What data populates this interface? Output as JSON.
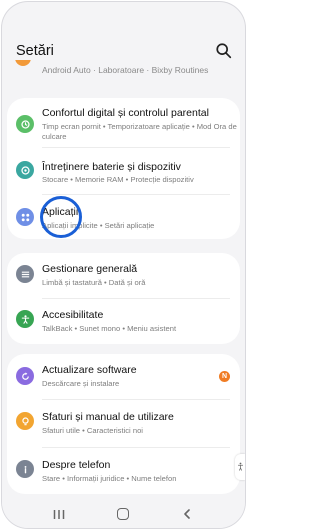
{
  "header": {
    "title": "Setări"
  },
  "partial_row": {
    "text": "Android Auto · Laboratoare · Bixby Routines"
  },
  "groups": [
    [
      {
        "title": "Confortul digital și controlul parental",
        "subtitle": "Timp ecran pornit • Temporizatoare aplicație • Mod Ora de culcare",
        "icon": "digital-wellbeing-icon",
        "color": "#5bbf68"
      },
      {
        "title": "Întreținere baterie și dispozitiv",
        "subtitle": "Stocare • Memorie RAM • Protecție dispozitiv",
        "icon": "device-care-icon",
        "color": "#3aa7a0"
      },
      {
        "title": "Aplicații",
        "subtitle": "Aplicații implicite • Setări aplicație",
        "icon": "apps-icon",
        "color": "#6f8fe6"
      }
    ],
    [
      {
        "title": "Gestionare generală",
        "subtitle": "Limbă și tastatură • Dată și oră",
        "icon": "general-management-icon",
        "color": "#7b8493"
      },
      {
        "title": "Accesibilitate",
        "subtitle": "TalkBack • Sunet mono • Meniu asistent",
        "icon": "accessibility-icon",
        "color": "#37a553"
      }
    ],
    [
      {
        "title": "Actualizare software",
        "subtitle": "Descărcare și instalare",
        "icon": "software-update-icon",
        "color": "#8a6be0",
        "badge": "N"
      },
      {
        "title": "Sfaturi și manual de utilizare",
        "subtitle": "Sfaturi utile • Caracteristici noi",
        "icon": "tips-icon",
        "color": "#f2a531"
      },
      {
        "title": "Despre telefon",
        "subtitle": "Stare • Informații juridice • Nume telefon",
        "icon": "about-phone-icon",
        "color": "#7b8493"
      }
    ]
  ]
}
